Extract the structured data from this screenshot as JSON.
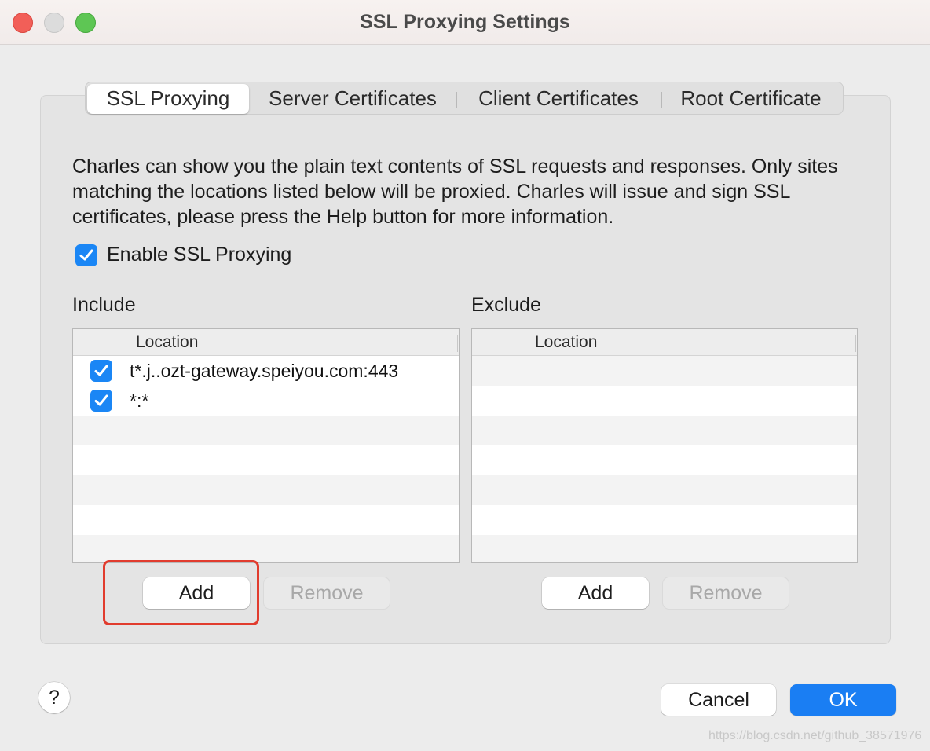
{
  "window": {
    "title": "SSL Proxying Settings"
  },
  "tabs": [
    {
      "label": "SSL Proxying",
      "active": true
    },
    {
      "label": "Server Certificates",
      "active": false
    },
    {
      "label": "Client Certificates",
      "active": false
    },
    {
      "label": "Root Certificate",
      "active": false
    }
  ],
  "description": "Charles can show you the plain text contents of SSL requests and responses. Only sites matching the locations listed below will be proxied. Charles will issue and sign SSL certificates, please press the Help button for more information.",
  "enable_ssl": {
    "label": "Enable SSL Proxying",
    "checked": true
  },
  "include": {
    "label": "Include",
    "column_header": "Location",
    "rows": [
      {
        "checked": true,
        "location": "t*.j..ozt-gateway.speiyou.com:443"
      },
      {
        "checked": true,
        "location": "*:*"
      }
    ],
    "add_label": "Add",
    "remove_label": "Remove"
  },
  "exclude": {
    "label": "Exclude",
    "column_header": "Location",
    "rows": [],
    "add_label": "Add",
    "remove_label": "Remove"
  },
  "footer": {
    "help_label": "?",
    "cancel_label": "Cancel",
    "ok_label": "OK"
  },
  "watermark": "https://blog.csdn.net/github_38571976",
  "colors": {
    "accent": "#1a7ef3",
    "highlight_box": "#e13c2e",
    "close": "#f25f58",
    "zoom": "#5ec654"
  }
}
